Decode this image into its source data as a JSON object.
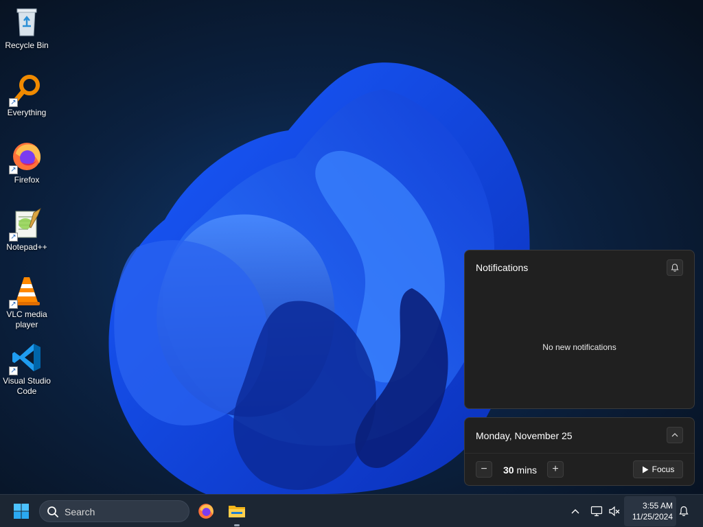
{
  "desktop": {
    "icons": [
      {
        "label": "Recycle Bin",
        "shortcut": false
      },
      {
        "label": "Everything",
        "shortcut": true
      },
      {
        "label": "Firefox",
        "shortcut": true
      },
      {
        "label": "Notepad++",
        "shortcut": true
      },
      {
        "label": "VLC media player",
        "shortcut": true
      },
      {
        "label": "Visual Studio Code",
        "shortcut": true
      }
    ],
    "shortcut_glyph": "↗"
  },
  "notifications": {
    "title": "Notifications",
    "empty_text": "No new notifications"
  },
  "calendar": {
    "date": "Monday, November 25",
    "focus_minutes": "30",
    "focus_unit": "mins",
    "minus": "−",
    "plus": "+",
    "focus_label": "Focus"
  },
  "taskbar": {
    "search_placeholder": "Search",
    "pinned": [
      "firefox-icon",
      "file-explorer-icon"
    ],
    "tray": [
      "chevron-up-icon",
      "network-icon",
      "volume-muted-icon",
      "bell-icon"
    ],
    "time": "3:55 AM",
    "date": "11/25/2024"
  },
  "colors": {
    "accent": "#0078d4",
    "panel": "#202020",
    "taskbar": "#1c2633"
  }
}
